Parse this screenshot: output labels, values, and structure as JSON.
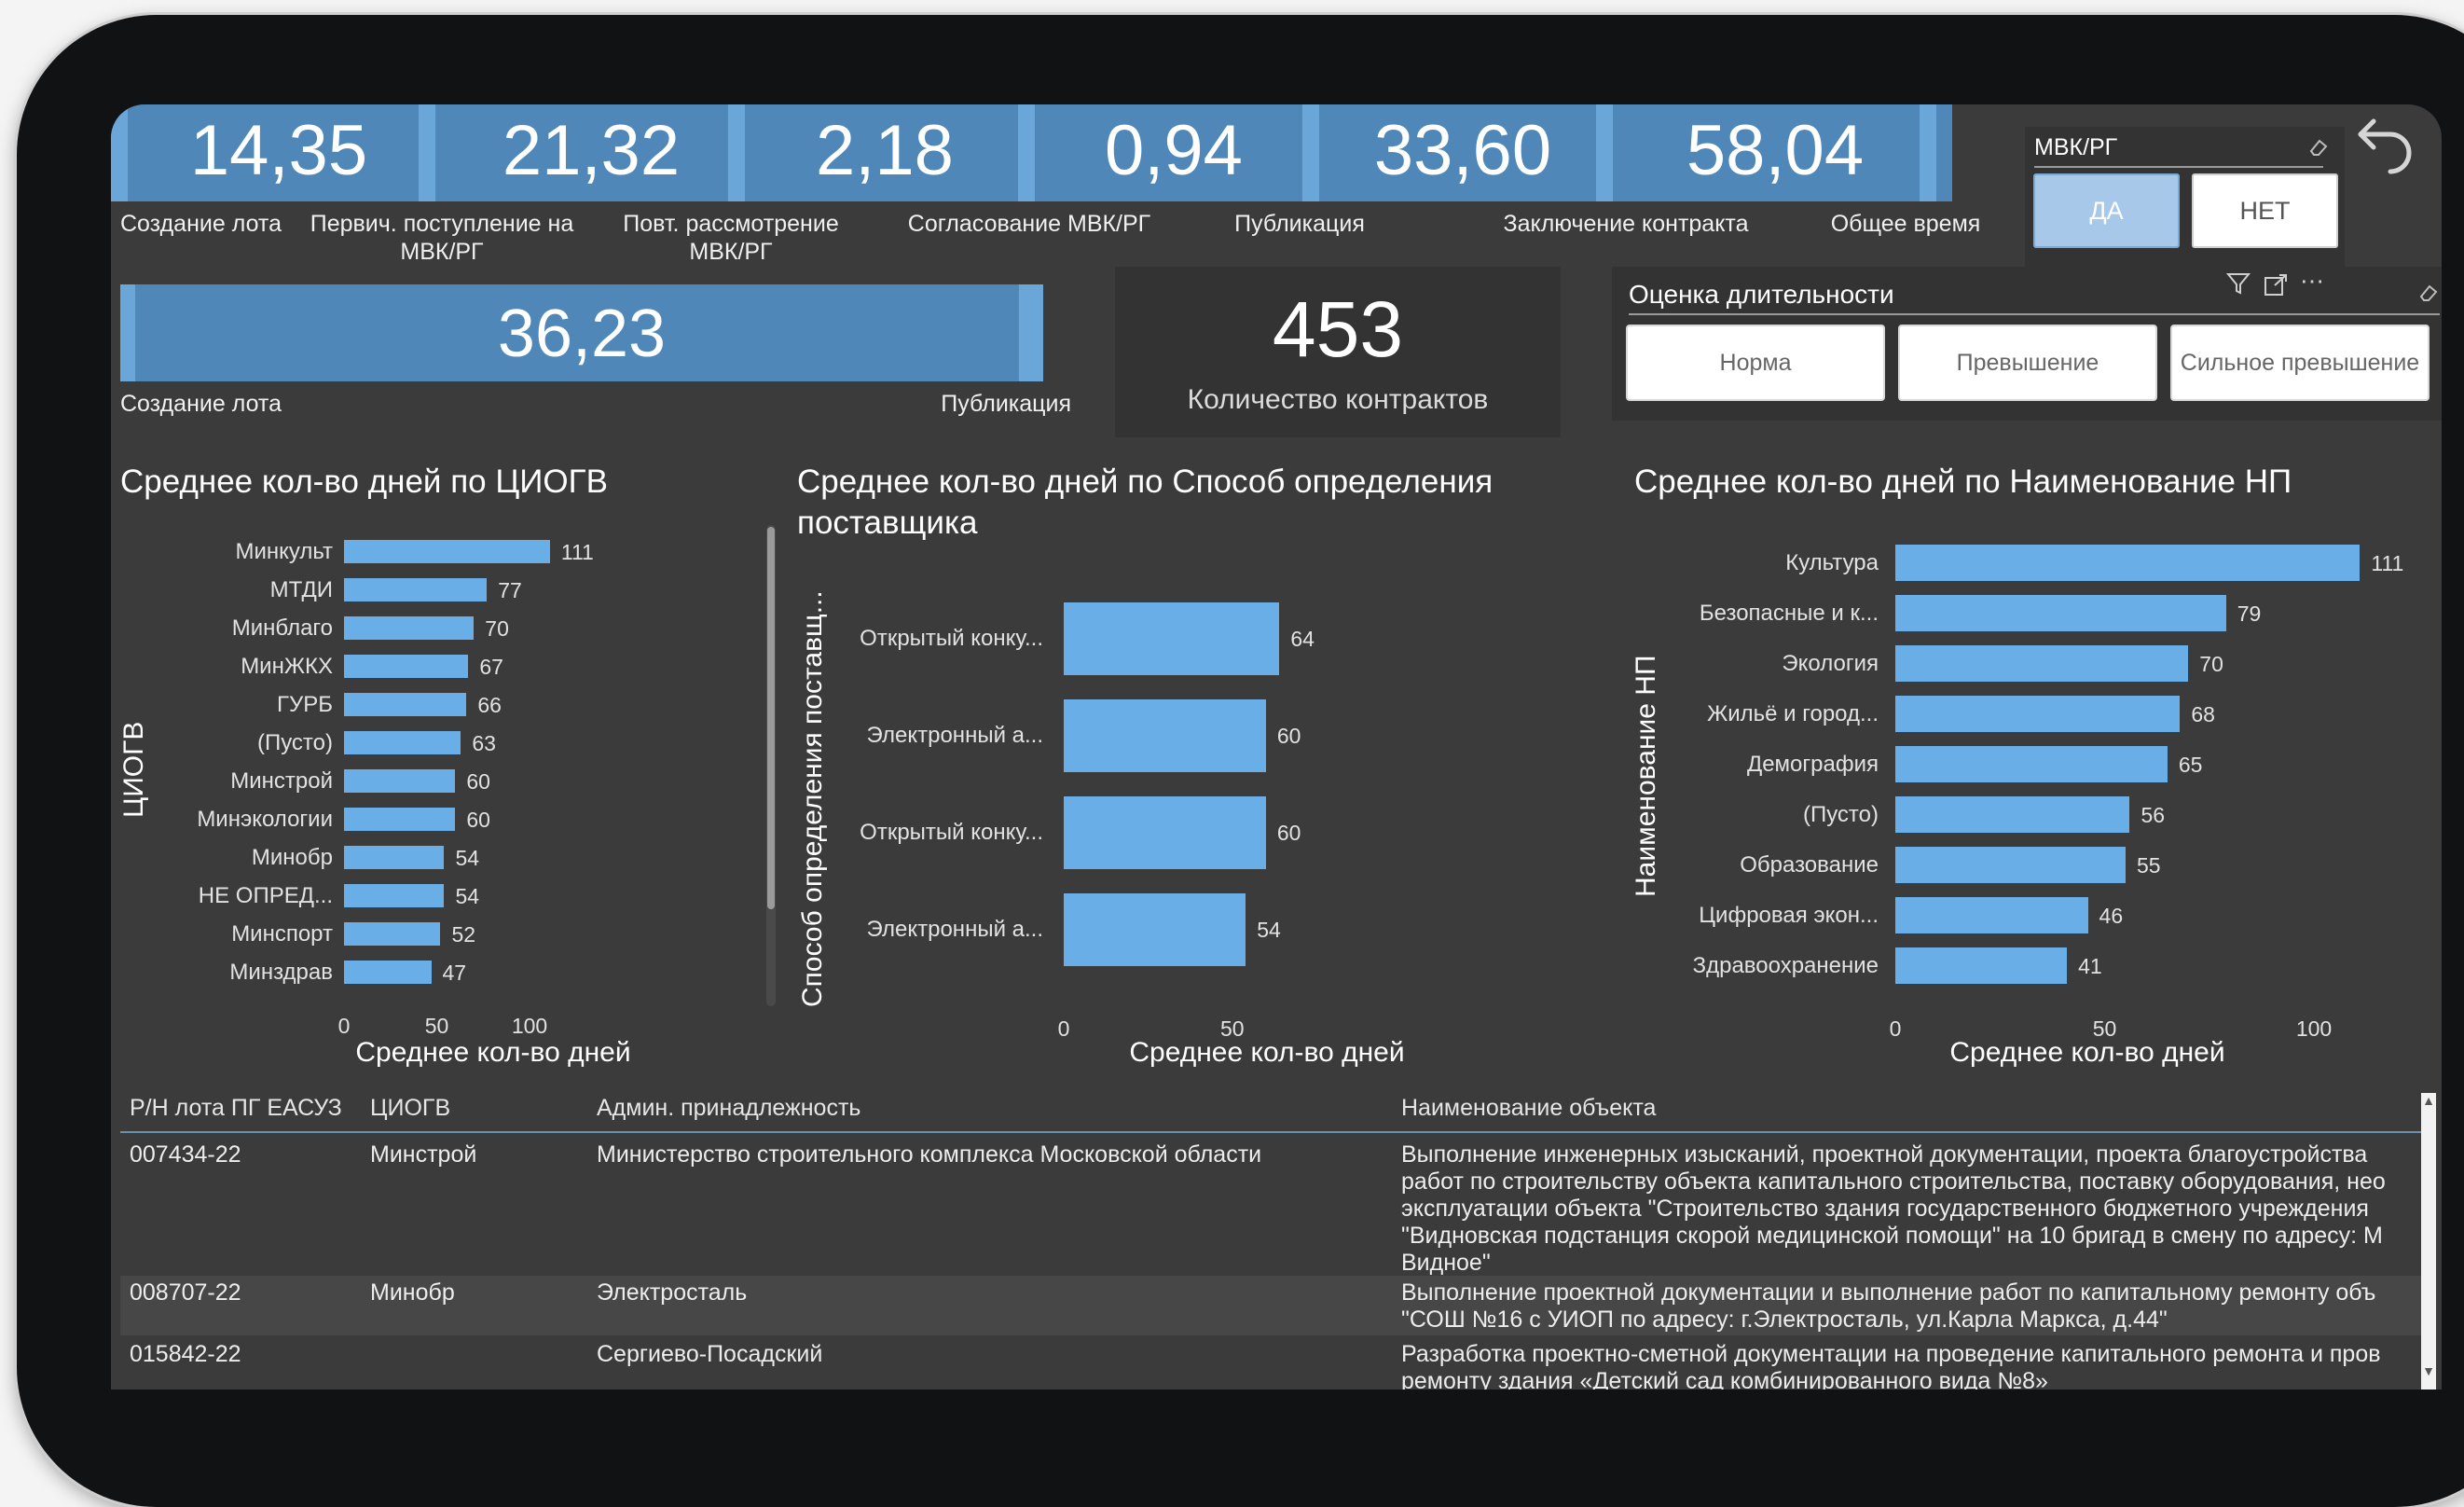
{
  "kpis": [
    {
      "value": "14,35",
      "label": "Создание лота"
    },
    {
      "value": "21,32",
      "label": "Первич. поступление на МВК/РГ"
    },
    {
      "value": "2,18",
      "label": "Повт. рассмотрение МВК/РГ"
    },
    {
      "value": "0,94",
      "label": "Согласование МВК/РГ"
    },
    {
      "value": "33,60",
      "label": "Публикация"
    },
    {
      "value": "58,04",
      "label": "Заключение контракта"
    },
    {
      "label": "Общее время"
    }
  ],
  "summary": {
    "value": "36,23",
    "start_label": "Создание лота",
    "end_label": "Публикация"
  },
  "contracts": {
    "count": "453",
    "label": "Количество контрактов"
  },
  "slicer_mvk": {
    "title": "МВК/РГ",
    "yes": "ДА",
    "no": "НЕТ",
    "selected": "ДА"
  },
  "duration": {
    "title": "Оценка длительности",
    "buttons": [
      "Норма",
      "Превышение",
      "Сильное превышение"
    ]
  },
  "colors": {
    "bar": "#6aaee8",
    "kpi_bg": "#4f88b8",
    "background": "#3b3b3b"
  },
  "icons": [
    "back-arrow-icon",
    "eraser-icon",
    "filter-icon",
    "focus-mode-icon",
    "more-options-icon",
    "scroll-up-icon",
    "scroll-down-icon"
  ],
  "chart_data": [
    {
      "type": "bar",
      "orientation": "horizontal",
      "title": "Среднее кол-во дней по ЦИОГВ",
      "xlabel": "Среднее кол-во дней",
      "ylabel": "ЦИОГВ",
      "categories": [
        "Минкульт",
        "МТДИ",
        "Минблаго",
        "МинЖКХ",
        "ГУРБ",
        "(Пусто)",
        "Минстрой",
        "Минэкологии",
        "Минобр",
        "НЕ ОПРЕД...",
        "Минспорт",
        "Минздрав"
      ],
      "values": [
        111,
        77,
        70,
        67,
        66,
        63,
        60,
        60,
        54,
        54,
        52,
        47
      ],
      "xticks": [
        0,
        50,
        100
      ],
      "xlim": [
        0,
        120
      ]
    },
    {
      "type": "bar",
      "orientation": "horizontal",
      "title": "Среднее кол-во дней по Способ определения поставщика",
      "xlabel": "Среднее кол-во дней",
      "ylabel": "Способ определения поставщ...",
      "categories": [
        "Открытый конку...",
        "Электронный а...",
        "Открытый конку...",
        "Электронный а..."
      ],
      "values": [
        64,
        60,
        60,
        54
      ],
      "xticks": [
        0,
        50
      ],
      "xlim": [
        0,
        80
      ]
    },
    {
      "type": "bar",
      "orientation": "horizontal",
      "title": "Среднее кол-во дней по Наименование НП",
      "xlabel": "Среднее кол-во дней",
      "ylabel": "Наименование НП",
      "categories": [
        "Культура",
        "Безопасные и к...",
        "Экология",
        "Жильё и город...",
        "Демография",
        "(Пусто)",
        "Образование",
        "Цифровая экон...",
        "Здравоохранение"
      ],
      "values": [
        111,
        79,
        70,
        68,
        65,
        56,
        55,
        46,
        41
      ],
      "xticks": [
        0,
        50,
        100
      ],
      "xlim": [
        0,
        125
      ]
    }
  ],
  "table": {
    "headers": [
      "Р/Н лота ПГ ЕАСУЗ",
      "ЦИОГВ",
      "Админ. принадлежность",
      "Наименование объекта"
    ],
    "rows": [
      {
        "id": "007434-22",
        "ciogv": "Минстрой",
        "admin": "Министерство строительного комплекса Московской области",
        "object": [
          "Выполнение инженерных изысканий, проектной документации, проекта благоустройства",
          "работ по строительству объекта капитального строительства, поставку оборудования, нео",
          "эксплуатации объекта \"Строительство здания государственного бюджетного учреждения",
          "\"Видновская подстанция скорой медицинской помощи\" на 10 бригад в смену по адресу: М",
          "Видное\""
        ]
      },
      {
        "id": "008707-22",
        "ciogv": "Минобр",
        "admin": "Электросталь",
        "object": [
          "Выполнение проектной документации и выполнение работ по капитальному ремонту объ",
          "\"СОШ №16 с УИОП по адресу: г.Электросталь, ул.Карла Маркса, д.44\""
        ]
      },
      {
        "id": "015842-22",
        "ciogv": "",
        "admin": "Сергиево-Посадский",
        "object": [
          "Разработка проектно-сметной документации на проведение капитального ремонта и пров",
          "ремонту здания «Детский сад комбинированного вида №8»"
        ]
      }
    ]
  }
}
